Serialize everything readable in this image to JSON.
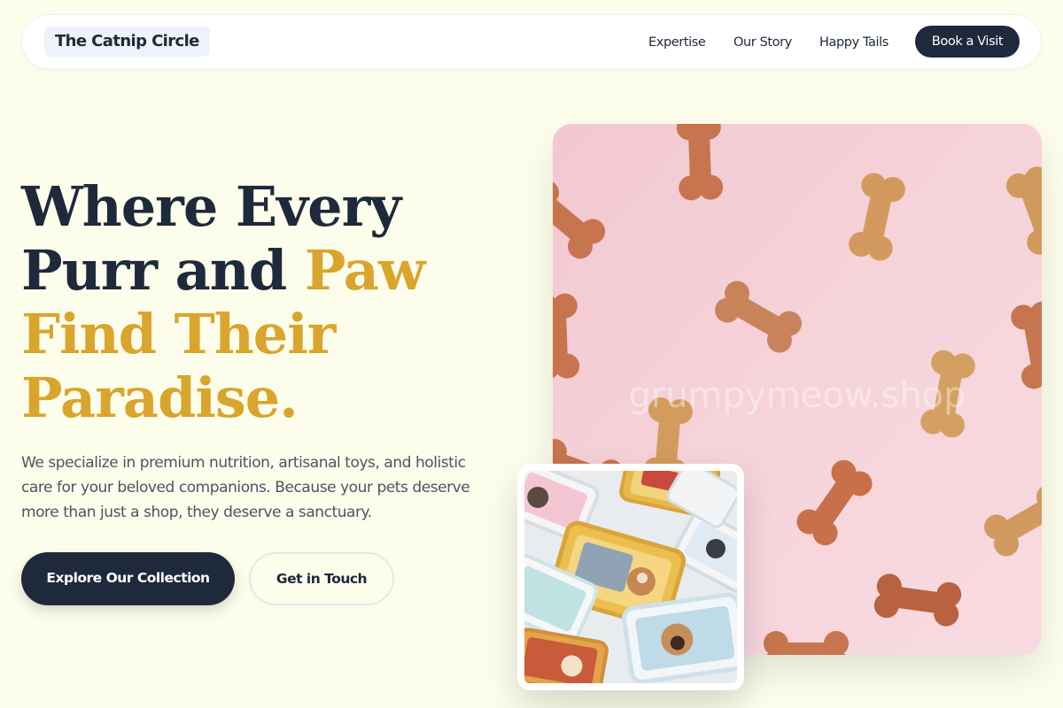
{
  "nav": {
    "logo": "The Catnip Circle",
    "links": [
      "Expertise",
      "Our Story",
      "Happy Tails"
    ],
    "cta": "Book a Visit"
  },
  "hero": {
    "headline": {
      "line1": "Where Every",
      "line2_dark": "Purr and",
      "line2_gold": "Paw",
      "line3": "Find Their",
      "line4": "Paradise."
    },
    "lead": "We specialize in premium nutrition, artisanal toys, and holistic care for your beloved companions. Because your pets deserve more than just a shop, they deserve a sanctuary.",
    "primary_button": "Explore Our Collection",
    "secondary_button": "Get in Touch"
  },
  "images": {
    "main_watermark": "grumpymeow.shop"
  },
  "colors": {
    "background": "#fdfdec",
    "navy": "#1e293b",
    "gold": "#d9a52d",
    "pink": "#f5d0d8"
  }
}
